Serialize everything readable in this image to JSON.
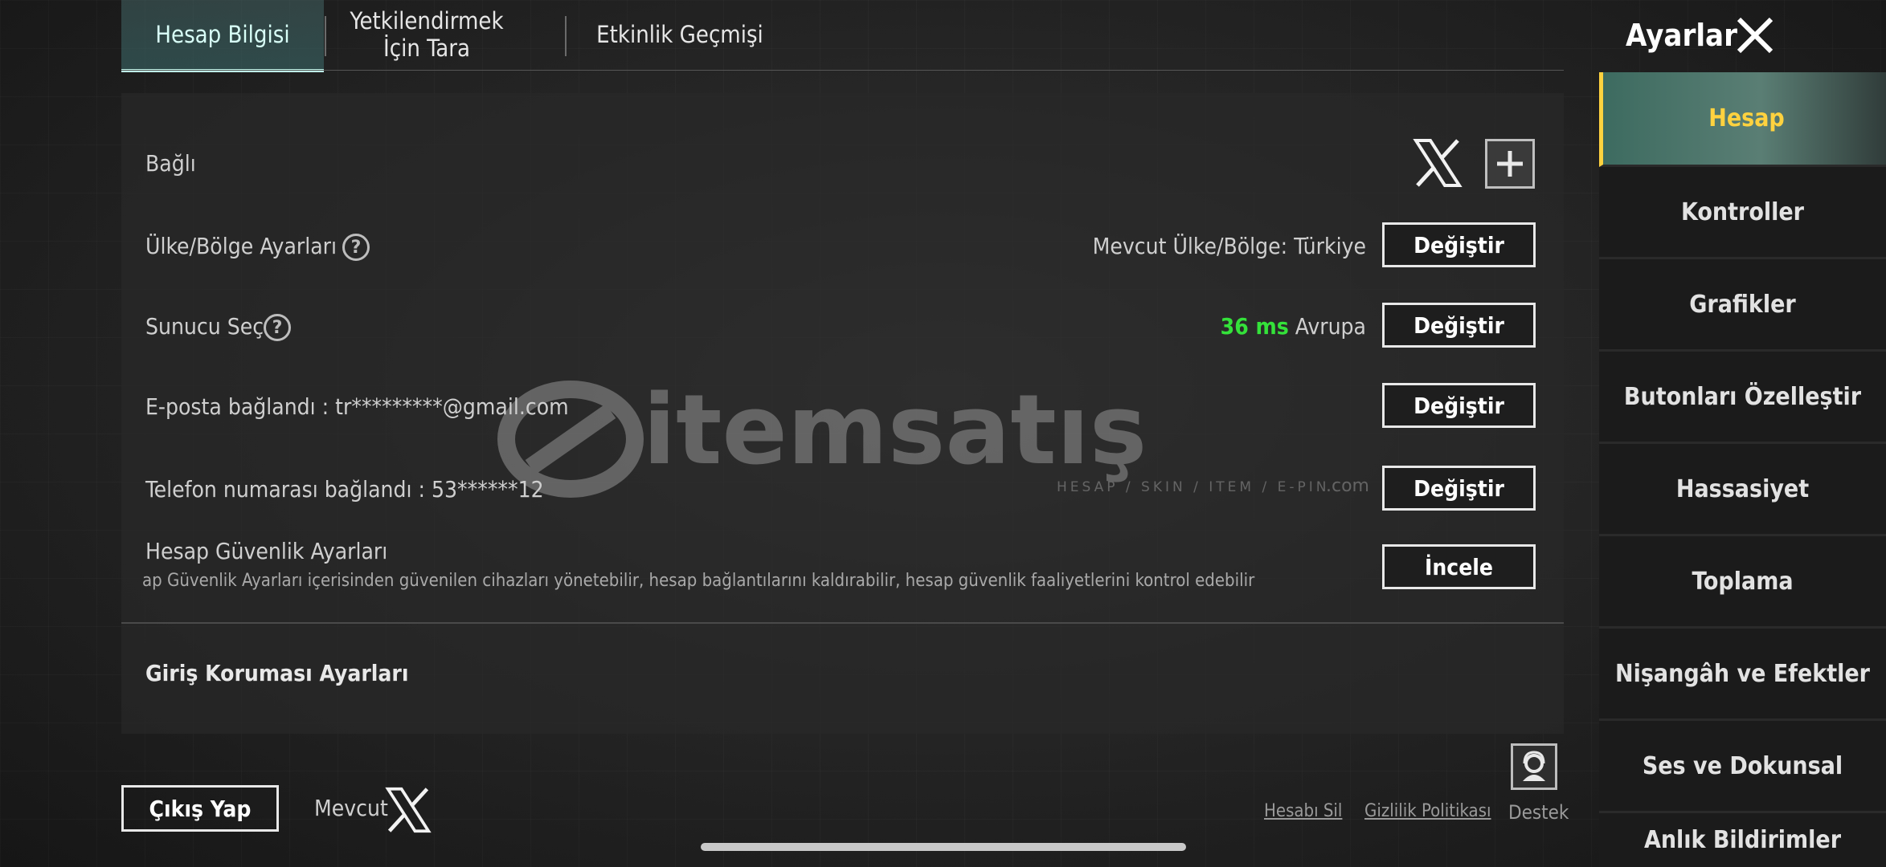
{
  "tabs": [
    {
      "label": "Hesap Bilgisi"
    },
    {
      "label": "Yetkilendirmek İçin Tara"
    },
    {
      "label": "Etkinlik Geçmişi"
    }
  ],
  "header": {
    "title": "Ayarlar"
  },
  "rows": {
    "linked": {
      "label": "Bağlı"
    },
    "country": {
      "label": "Ülke/Bölge Ayarları",
      "current": "Mevcut Ülke/Bölge: Türkiye",
      "button": "Değiştir"
    },
    "server": {
      "label": "Sunucu Seç",
      "ping": "36 ms",
      "region": "Avrupa",
      "button": "Değiştir"
    },
    "email": {
      "label": "E-posta bağlandı : tr*********@gmail.com",
      "button": "Değiştir"
    },
    "phone": {
      "label": "Telefon numarası bağlandı : 53******12",
      "button": "Değiştir"
    },
    "security": {
      "label": "Hesap Güvenlik Ayarları",
      "desc": "ap Güvenlik Ayarları içerisinden güvenilen cihazları yönetebilir, hesap bağlantılarını kaldırabilir, hesap güvenlik faaliyetlerini kontrol edebilir",
      "button": "İncele"
    },
    "login_protection": {
      "label": "Giriş Koruması Ayarları"
    }
  },
  "sidebar": {
    "items": [
      {
        "label": "Hesap"
      },
      {
        "label": "Kontroller"
      },
      {
        "label": "Grafikler"
      },
      {
        "label": "Butonları Özelleştir"
      },
      {
        "label": "Hassasiyet"
      },
      {
        "label": "Toplama"
      },
      {
        "label": "Nişangâh ve Efektler"
      },
      {
        "label": "Ses ve Dokunsal"
      },
      {
        "label": "Anlık Bildirimler"
      }
    ]
  },
  "footer": {
    "logout": "Çıkış Yap",
    "current": "Mevcut",
    "delete_account": "Hesabı Sil",
    "privacy": "Gizlilik Politikası",
    "support": "Destek"
  },
  "watermark": {
    "brand": "itemsatış",
    "tagline": "HESAP / SKIN / ITEM / E-PIN",
    "domain": ".com"
  },
  "colors": {
    "accent": "#ffd23f",
    "ping": "#34e23a",
    "tab_active": "#bff5ea"
  },
  "icons": {
    "linked": "x-logo-icon",
    "add": "plus-icon",
    "close": "close-icon",
    "support": "headset-icon"
  }
}
